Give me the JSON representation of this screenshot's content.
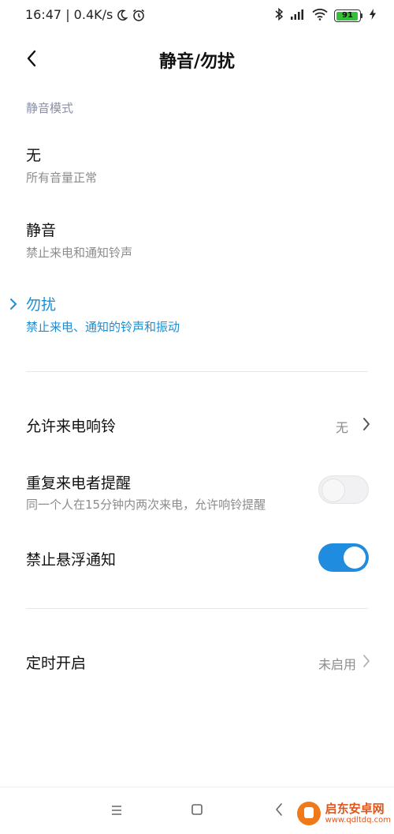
{
  "status_bar": {
    "time_speed": "16:47 | 0.4K/s",
    "battery_level": "91",
    "icons": [
      "moon-icon",
      "alarm-icon",
      "bluetooth-icon",
      "signal-icon",
      "wifi-icon",
      "battery-icon",
      "charging-icon"
    ]
  },
  "header": {
    "title": "静音/勿扰",
    "back_icon": "back-arrow-icon"
  },
  "silent_mode": {
    "section_label": "静音模式",
    "options": [
      {
        "title": "无",
        "description": "所有音量正常",
        "selected": false
      },
      {
        "title": "静音",
        "description": "禁止来电和通知铃声",
        "selected": false
      },
      {
        "title": "勿扰",
        "description": "禁止来电、通知的铃声和振动",
        "selected": true
      }
    ]
  },
  "settings": {
    "allow_calls": {
      "title": "允许来电响铃",
      "value": "无"
    },
    "repeat_callers": {
      "title": "重复来电者提醒",
      "description": "同一个人在15分钟内两次来电，允许响铃提醒",
      "enabled": false
    },
    "block_floating": {
      "title": "禁止悬浮通知",
      "enabled": true
    },
    "scheduled": {
      "title": "定时开启",
      "value": "未启用"
    }
  },
  "nav_bar": {
    "icons": [
      "menu-icon",
      "home-icon",
      "back-icon"
    ]
  },
  "watermark": {
    "name": "启东安卓网",
    "url": "www.qdltdq.com"
  },
  "colors": {
    "accent": "#1a8fd6",
    "toggle_on": "#1f8ce0",
    "battery": "#35c03c",
    "section_label": "#8a8fa8"
  }
}
